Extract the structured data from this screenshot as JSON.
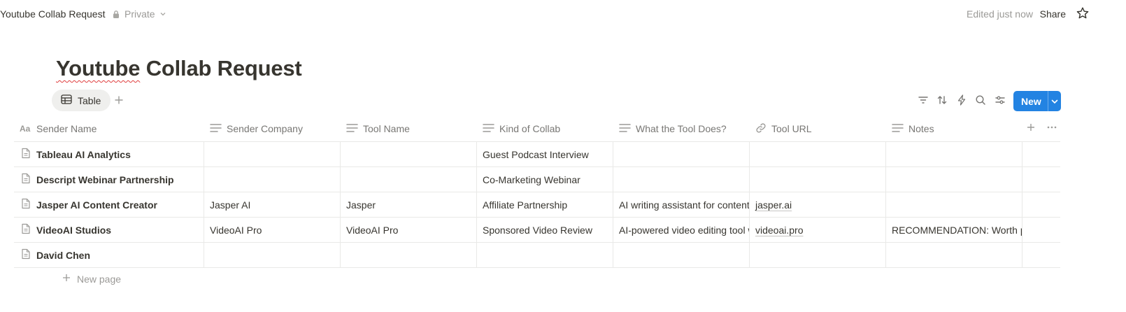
{
  "topbar": {
    "breadcrumb": "Youtube Collab Request",
    "privacy": "Private",
    "edited": "Edited just now",
    "share": "Share",
    "icons": [
      "lock-icon",
      "chevron-down-icon",
      "star-icon"
    ]
  },
  "page": {
    "title_part1": "Youtube",
    "title_part2": " Collab Request"
  },
  "views": {
    "active_tab": "Table",
    "add_icon": "plus-icon"
  },
  "toolbar": {
    "icons": [
      "filter-icon",
      "sort-icon",
      "automation-icon",
      "search-icon",
      "settings-icon"
    ],
    "new_label": "New",
    "accent": "#2383e2"
  },
  "table": {
    "columns": [
      {
        "label": "Sender Name",
        "icon": "title-icon"
      },
      {
        "label": "Sender Company",
        "icon": "text-icon"
      },
      {
        "label": "Tool Name",
        "icon": "text-icon"
      },
      {
        "label": "Kind of Collab",
        "icon": "text-icon"
      },
      {
        "label": "What the Tool Does?",
        "icon": "text-icon"
      },
      {
        "label": "Tool URL",
        "icon": "link-icon"
      },
      {
        "label": "Notes",
        "icon": "text-icon"
      }
    ],
    "rows": [
      [
        "Tableau AI Analytics",
        "",
        "",
        "Guest Podcast Interview",
        "",
        "",
        ""
      ],
      [
        "Descript Webinar Partnership",
        "",
        "",
        "Co-Marketing Webinar",
        "",
        "",
        ""
      ],
      [
        "Jasper AI Content Creator",
        "Jasper AI",
        "Jasper",
        "Affiliate Partnership",
        "AI writing assistant for content",
        "jasper.ai",
        ""
      ],
      [
        "VideoAI Studios",
        "VideoAI Pro",
        "VideoAI Pro",
        "Sponsored Video Review",
        "AI-powered video editing tool w",
        "videoai.pro",
        "RECOMMENDATION: Worth pur"
      ],
      [
        "David Chen",
        "",
        "",
        "",
        "",
        "",
        ""
      ]
    ],
    "new_page": "New page"
  }
}
